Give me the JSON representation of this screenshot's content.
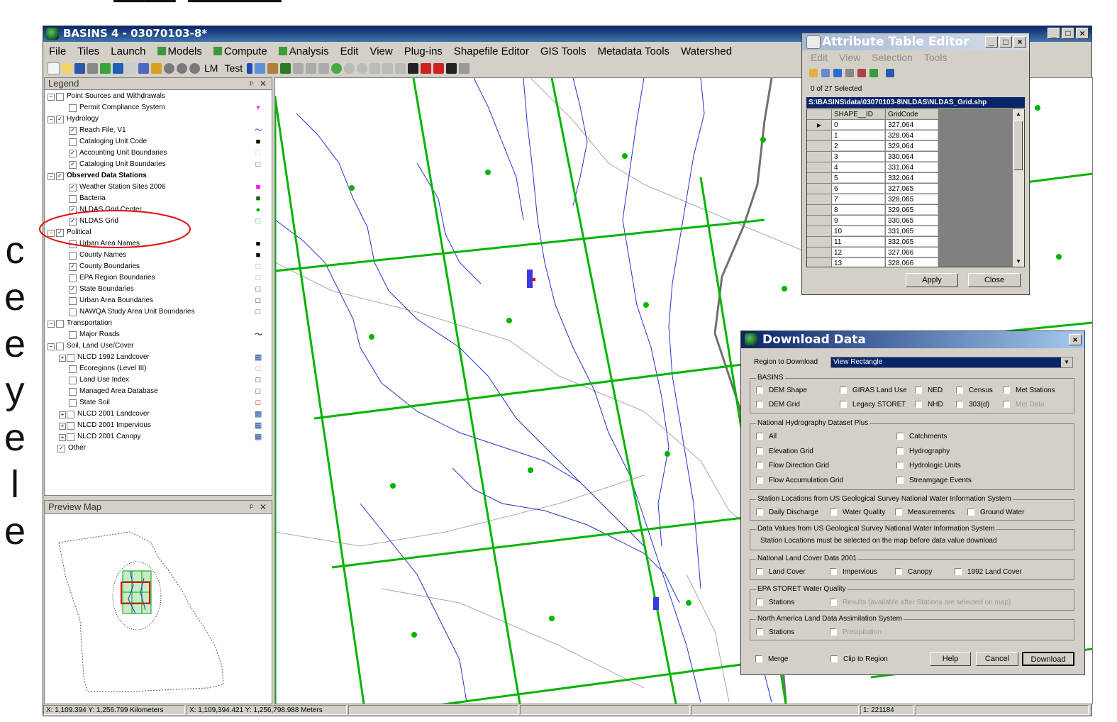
{
  "main_window": {
    "title": "BASINS 4  - 03070103-8*",
    "menus": [
      "File",
      "Tiles",
      "Launch",
      "Models",
      "Compute",
      "Analysis",
      "Edit",
      "View",
      "Plug-ins",
      "Shapefile Editor",
      "GIS Tools",
      "Metadata Tools",
      "Watershed"
    ],
    "toolbar_text": [
      "LM",
      "Test"
    ]
  },
  "legend": {
    "title": "Legend",
    "rows": [
      {
        "label": "Point Sources and Withdrawals",
        "level": 0,
        "checked": false,
        "bold": false
      },
      {
        "label": "Permit Compliance System",
        "level": 1,
        "checked": false,
        "symbol": "▾",
        "color": "#e040e0"
      },
      {
        "label": "Hydrology",
        "level": 0,
        "checked": true
      },
      {
        "label": "Reach File, V1",
        "level": 1,
        "checked": true,
        "symbol": "～",
        "color": "#1d1dcc"
      },
      {
        "label": "Cataloging Unit Code",
        "level": 1,
        "checked": false,
        "symbol": "■",
        "color": "#000000"
      },
      {
        "label": "Accounting Unit Boundaries",
        "level": 1,
        "checked": true,
        "symbol": "□",
        "color": "#c0c0c0"
      },
      {
        "label": "Cataloging Unit Boundaries",
        "level": 1,
        "checked": true,
        "symbol": "□",
        "color": "#404040"
      },
      {
        "label": "Observed Data Stations",
        "level": 0,
        "checked": true,
        "bold": true
      },
      {
        "label": "Weather Station Sites 2006",
        "level": 1,
        "checked": true,
        "symbol": "■",
        "color": "#ff00ff"
      },
      {
        "label": "Bacteria",
        "level": 1,
        "checked": false,
        "symbol": "■",
        "color": "#006600"
      },
      {
        "label": "NLDAS Grid Center",
        "level": 1,
        "checked": true,
        "symbol": "●",
        "color": "#00aa00"
      },
      {
        "label": "NLDAS Grid",
        "level": 1,
        "checked": true,
        "symbol": "□",
        "color": "#00aa00"
      },
      {
        "label": "Political",
        "level": 0,
        "checked": true
      },
      {
        "label": "Urban Area Names",
        "level": 1,
        "checked": false,
        "symbol": "■",
        "color": "#000000"
      },
      {
        "label": "County Names",
        "level": 1,
        "checked": false,
        "symbol": "■",
        "color": "#000000"
      },
      {
        "label": "County Boundaries",
        "level": 1,
        "checked": true,
        "symbol": "□",
        "color": "#a0a0a0"
      },
      {
        "label": "EPA Region Boundaries",
        "level": 1,
        "checked": false,
        "symbol": "□",
        "color": "#a0a0a0"
      },
      {
        "label": "State Boundaries",
        "level": 1,
        "checked": true,
        "symbol": "□",
        "color": "#000000"
      },
      {
        "label": "Urban Area Boundaries",
        "level": 1,
        "checked": false,
        "symbol": "□",
        "color": "#000000"
      },
      {
        "label": "NAWQA Study Area Unit Boundaries",
        "level": 1,
        "checked": false,
        "symbol": "□",
        "color": "#008800"
      },
      {
        "label": "Transportation",
        "level": 0,
        "checked": false
      },
      {
        "label": "Major Roads",
        "level": 1,
        "checked": false,
        "symbol": "～",
        "color": "#000000"
      },
      {
        "label": "Soil, Land Use/Cover",
        "level": 0,
        "checked": false
      },
      {
        "label": "NLCD 1992 Landcover",
        "level": 1,
        "checked": false,
        "expand": true,
        "symbol": "▦",
        "color": "#1a4a9a"
      },
      {
        "label": "Ecoregions (Level III)",
        "level": 1,
        "checked": false,
        "symbol": "□",
        "color": "#a0a0a0"
      },
      {
        "label": "Land Use Index",
        "level": 1,
        "checked": false,
        "symbol": "□",
        "color": "#000000"
      },
      {
        "label": "Managed Area Database",
        "level": 1,
        "checked": false,
        "symbol": "□",
        "color": "#000000"
      },
      {
        "label": "State Soil",
        "level": 1,
        "checked": false,
        "symbol": "□",
        "color": "#aa0000"
      },
      {
        "label": "NLCD 2001 Landcover",
        "level": 1,
        "checked": false,
        "expand": true,
        "symbol": "▦",
        "color": "#1a4a9a"
      },
      {
        "label": "NLCD 2001 Impervious",
        "level": 1,
        "checked": false,
        "expand": true,
        "symbol": "▦",
        "color": "#1a4a9a"
      },
      {
        "label": "NLCD 2001 Canopy",
        "level": 1,
        "checked": false,
        "expand": true,
        "symbol": "▦",
        "color": "#1a4a9a"
      },
      {
        "label": "Other",
        "level": 0,
        "checked": true,
        "noexpand": true
      }
    ]
  },
  "preview": {
    "title": "Preview Map"
  },
  "statusbar": {
    "km": "X: 1,109.394 Y: 1,256.799 Kilometers",
    "m": "X: 1,109,394.421 Y: 1,256,798.988 Meters",
    "scale": "1: 221184"
  },
  "attribute_table": {
    "title": "Attribute Table Editor",
    "menus": [
      "Edit",
      "View",
      "Selection",
      "Tools"
    ],
    "selection_info": "0 of 27 Selected",
    "path": "S:\\BASINS\\data\\03070103-8\\NLDAS\\NLDAS_Grid.shp",
    "columns": [
      "SHAPE__ID",
      "GridCode"
    ],
    "rows": [
      [
        "0",
        "327,064"
      ],
      [
        "1",
        "328,064"
      ],
      [
        "2",
        "329,064"
      ],
      [
        "3",
        "330,064"
      ],
      [
        "4",
        "331,064"
      ],
      [
        "5",
        "332,064"
      ],
      [
        "6",
        "327,065"
      ],
      [
        "7",
        "328,065"
      ],
      [
        "8",
        "329,065"
      ],
      [
        "9",
        "330,065"
      ],
      [
        "10",
        "331,065"
      ],
      [
        "11",
        "332,065"
      ],
      [
        "12",
        "327,066"
      ],
      [
        "13",
        "328,066"
      ]
    ],
    "apply_label": "Apply",
    "close_label": "Close"
  },
  "download": {
    "title": "Download Data",
    "region_label": "Region to Download",
    "region_value": "View Rectangle",
    "basins_label": "BASINS",
    "basins": [
      "DEM Shape",
      "GIRAS Land Use",
      "NED",
      "Census",
      "Met Stations",
      "DEM Grid",
      "Legacy STORET",
      "NHD",
      "303(d)",
      "Met Data"
    ],
    "nhd_label": "National Hydrography Dataset Plus",
    "nhd_left": [
      "All",
      "Elevation Grid",
      "Flow Direction Grid",
      "Flow Accumulation Grid"
    ],
    "nhd_right": [
      "Catchments",
      "Hydrography",
      "Hydrologic Units",
      "Streamgage Events"
    ],
    "nwis_loc_label": "Station Locations from US Geological Survey National Water Information System",
    "nwis_loc": [
      "Daily Discharge",
      "Water Quality",
      "Measurements",
      "Ground Water"
    ],
    "nwis_val_label": "Data Values from US Geological Survey National Water Information System",
    "nwis_val_note": "Station Locations must be selected on the map before data value download",
    "nlcd_label": "National Land Cover Data 2001",
    "nlcd": [
      "Land Cover",
      "Impervious",
      "Canopy",
      "1992 Land Cover"
    ],
    "storet_label": "EPA STORET Water Quality",
    "storet": [
      "Stations",
      "Results (available after Stations are selected on map)"
    ],
    "nldas_label": "North America Land Data Assimilation System",
    "nldas": [
      "Stations",
      "Precipitation"
    ],
    "merge_label": "Merge",
    "clip_label": "Clip to Region",
    "help_label": "Help",
    "cancel_label": "Cancel",
    "download_label": "Download"
  },
  "colors": {
    "grid_green": "#00b400",
    "river_blue": "#2233cc",
    "boundary_gray": "#a0a0a0",
    "highlight_red": "#dd1111"
  }
}
